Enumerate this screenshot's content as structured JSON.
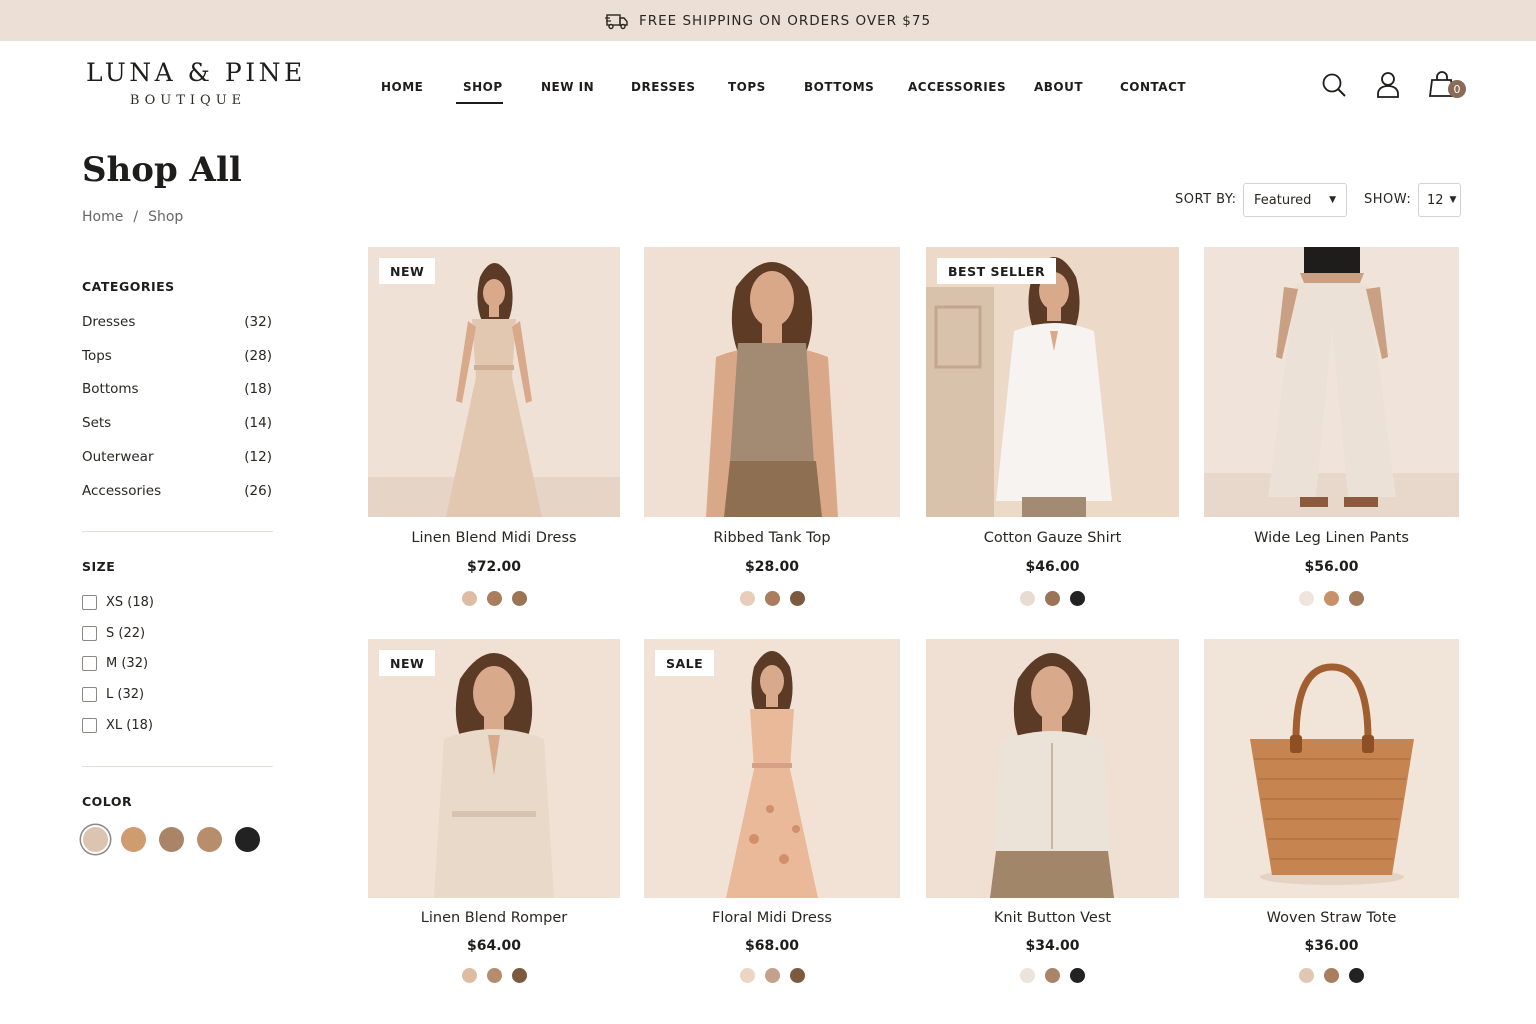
{
  "announcement": {
    "text": "FREE SHIPPING ON ORDERS OVER $75",
    "icon": "truck-icon"
  },
  "brand": {
    "name": "LUNA & PINE",
    "tagline": "BOUTIQUE"
  },
  "nav": {
    "items": [
      "HOME",
      "SHOP",
      "NEW IN",
      "DRESSES",
      "TOPS",
      "BOTTOMS",
      "ACCESSORIES",
      "ABOUT",
      "CONTACT"
    ],
    "active": "SHOP"
  },
  "header_icons": {
    "search": "search-icon",
    "account": "user-icon",
    "cart": "shopping-bag-icon",
    "cart_count": "0"
  },
  "page": {
    "title": "Shop All",
    "breadcrumb": [
      "Home",
      "/",
      "Shop"
    ]
  },
  "sort": {
    "label": "SORT BY:",
    "value": "Featured",
    "show_label": "SHOW:",
    "show_value": "12"
  },
  "sidebar": {
    "categories_heading": "CATEGORIES",
    "categories": [
      {
        "name": "Dresses",
        "count": "(32)"
      },
      {
        "name": "Tops",
        "count": "(28)"
      },
      {
        "name": "Bottoms",
        "count": "(18)"
      },
      {
        "name": "Sets",
        "count": "(14)"
      },
      {
        "name": "Outerwear",
        "count": "(12)"
      },
      {
        "name": "Accessories",
        "count": "(26)"
      }
    ],
    "size_heading": "SIZE",
    "sizes": [
      "XS (18)",
      "S (22)",
      "M (32)",
      "L (32)",
      "XL (18)"
    ],
    "color_heading": "COLOR",
    "colors": [
      "#dcc4b2",
      "#cf9c70",
      "#a98466",
      "#b88d6c",
      "#222222"
    ]
  },
  "products": [
    {
      "name": "Linen Blend Midi Dress",
      "price": "$72.00",
      "badge": "NEW",
      "swatches": [
        "#dcbda4",
        "#a97d5e",
        "#9b7456"
      ]
    },
    {
      "name": "Ribbed Tank Top",
      "price": "$28.00",
      "badge": "",
      "swatches": [
        "#e7cdb9",
        "#a97d5e",
        "#7b5a40"
      ]
    },
    {
      "name": "Cotton Gauze Shirt",
      "price": "$46.00",
      "badge": "BEST SELLER",
      "swatches": [
        "#e6dcd2",
        "#9b7456",
        "#222222"
      ]
    },
    {
      "name": "Wide Leg Linen Pants",
      "price": "$56.00",
      "badge": "",
      "swatches": [
        "#efe5dc",
        "#c8916a",
        "#a2795a"
      ]
    },
    {
      "name": "Linen Blend Romper",
      "price": "$64.00",
      "badge": "NEW",
      "swatches": [
        "#dcbda4",
        "#b58c6c",
        "#7b5a40"
      ]
    },
    {
      "name": "Floral Midi Dress",
      "price": "$68.00",
      "badge": "SALE",
      "swatches": [
        "#ecd5c3",
        "#c4a28a",
        "#7b5a40"
      ]
    },
    {
      "name": "Knit Button Vest",
      "price": "$34.00",
      "badge": "",
      "swatches": [
        "#ece3da",
        "#a98466",
        "#222222"
      ]
    },
    {
      "name": "Woven Straw Tote",
      "price": "$36.00",
      "badge": "",
      "swatches": [
        "#e0c7b4",
        "#a97d5e",
        "#222222"
      ]
    }
  ]
}
